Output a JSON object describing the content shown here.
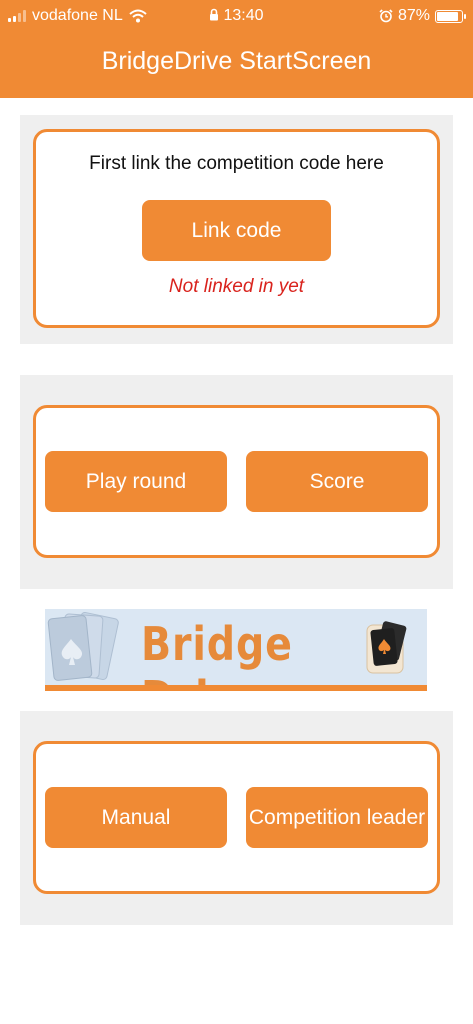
{
  "status_bar": {
    "carrier": "vodafone NL",
    "time": "13:40",
    "battery": "87%",
    "battery_level": 0.87
  },
  "header": {
    "title": "BridgeDrive StartScreen"
  },
  "link_section": {
    "instruction": "First link the competition code here",
    "link_button": "Link code",
    "status": "Not linked in yet"
  },
  "play_section": {
    "play_button": "Play round",
    "score_button": "Score"
  },
  "banner": {
    "text": "Bridge Drive"
  },
  "help_section": {
    "manual_button": "Manual",
    "leader_button": "Competition leader"
  },
  "colors": {
    "accent": "#f08a34",
    "status_red": "#d9231d",
    "panel_bg": "#efefef"
  }
}
